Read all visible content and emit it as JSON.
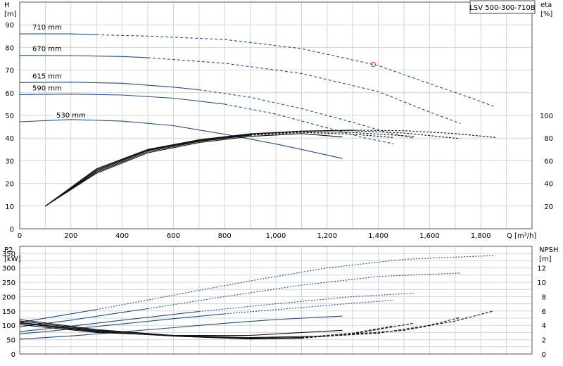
{
  "chart_data": [
    {
      "id": "head-efficiency",
      "type": "line",
      "model_label": "LSV 500-300-710B",
      "ylabel_left": "H",
      "ylabel_left_unit": "[m]",
      "ylabel_right": "eta",
      "ylabel_right_unit": "[%]",
      "xlabel": "Q [m³/h]",
      "xlim": [
        0,
        2000
      ],
      "ylim_left": [
        0,
        100
      ],
      "ylim_right": [
        0,
        200
      ],
      "x_ticks": [
        0,
        200,
        400,
        600,
        800,
        1000,
        1200,
        1400,
        1600,
        1800
      ],
      "x_tick_labels": [
        "0",
        "200",
        "400",
        "600",
        "800",
        "1,000",
        "1,200",
        "1,400",
        "1,600",
        "1,800"
      ],
      "y_left_ticks": [
        0,
        10,
        20,
        30,
        40,
        50,
        60,
        70,
        80,
        90
      ],
      "y_right_ticks": [
        20,
        40,
        60,
        80,
        100
      ],
      "grid": true,
      "color": "#1f4e8c",
      "efficiency_color": "#111111",
      "duty_point": {
        "x": 1380,
        "y": 72.5,
        "color": "#e03030"
      },
      "head_series": [
        {
          "name": "710 mm",
          "solid": [
            [
              0,
              86
            ],
            [
              100,
              86
            ],
            [
              200,
              86
            ],
            [
              300,
              85.6
            ]
          ],
          "dashed": [
            [
              300,
              85.6
            ],
            [
              500,
              85
            ],
            [
              800,
              83.5
            ],
            [
              1100,
              79.5
            ],
            [
              1400,
              72
            ],
            [
              1600,
              64
            ],
            [
              1780,
              57
            ],
            [
              1850,
              54
            ]
          ]
        },
        {
          "name": "670 mm",
          "solid": [
            [
              0,
              76.5
            ],
            [
              200,
              76.4
            ],
            [
              400,
              76
            ],
            [
              500,
              75.5
            ]
          ],
          "dashed": [
            [
              500,
              75.5
            ],
            [
              800,
              73
            ],
            [
              1100,
              68.5
            ],
            [
              1400,
              60.5
            ],
            [
              1600,
              51.5
            ],
            [
              1720,
              46.5
            ]
          ]
        },
        {
          "name": "615 mm",
          "solid": [
            [
              0,
              64.5
            ],
            [
              200,
              64.7
            ],
            [
              400,
              64.2
            ],
            [
              600,
              62.5
            ],
            [
              700,
              61.3
            ]
          ],
          "dashed": [
            [
              700,
              61.3
            ],
            [
              900,
              58
            ],
            [
              1100,
              53
            ],
            [
              1300,
              47
            ],
            [
              1450,
              42
            ],
            [
              1540,
              40
            ]
          ]
        },
        {
          "name": "590 mm",
          "solid": [
            [
              0,
              59.2
            ],
            [
              200,
              59.4
            ],
            [
              400,
              59
            ],
            [
              600,
              57.6
            ],
            [
              800,
              55
            ]
          ],
          "dashed": [
            [
              800,
              55
            ],
            [
              1000,
              50.6
            ],
            [
              1200,
              44.5
            ],
            [
              1350,
              40
            ],
            [
              1460,
              37.5
            ]
          ]
        },
        {
          "name": "530 mm",
          "solid": [
            [
              0,
              47.2
            ],
            [
              200,
              48.2
            ],
            [
              400,
              47.5
            ],
            [
              600,
              45.5
            ],
            [
              800,
              41.7
            ],
            [
              1000,
              37.4
            ],
            [
              1100,
              35
            ],
            [
              1260,
              31
            ]
          ],
          "dashed": []
        }
      ],
      "efficiency_series": [
        {
          "name": "710 mm",
          "solid": [
            [
              100,
              20
            ],
            [
              300,
              53
            ],
            [
              500,
              70
            ],
            [
              700,
              78.5
            ],
            [
              900,
              83.8
            ],
            [
              1100,
              86.2
            ],
            [
              1300,
              87
            ]
          ],
          "dashed": [
            [
              1300,
              87
            ],
            [
              1500,
              86.5
            ],
            [
              1700,
              84
            ],
            [
              1860,
              80.5
            ]
          ]
        },
        {
          "name": "670 mm",
          "solid": [
            [
              100,
              20
            ],
            [
              300,
              52
            ],
            [
              500,
              69.5
            ],
            [
              700,
              78
            ],
            [
              900,
              83.5
            ],
            [
              1100,
              86
            ]
          ],
          "dashed": [
            [
              1100,
              86
            ],
            [
              1300,
              86.5
            ],
            [
              1500,
              84.5
            ],
            [
              1720,
              79.5
            ]
          ]
        },
        {
          "name": "615 mm",
          "solid": [
            [
              100,
              20
            ],
            [
              300,
              51
            ],
            [
              500,
              69
            ],
            [
              700,
              77.6
            ],
            [
              900,
              83
            ]
          ],
          "dashed": [
            [
              900,
              83
            ],
            [
              1100,
              85.5
            ],
            [
              1300,
              85
            ],
            [
              1540,
              81.5
            ]
          ]
        },
        {
          "name": "590 mm",
          "solid": [
            [
              100,
              20
            ],
            [
              300,
              50
            ],
            [
              500,
              68
            ],
            [
              700,
              77
            ],
            [
              900,
              82.5
            ]
          ],
          "dashed": [
            [
              900,
              82.5
            ],
            [
              1100,
              85
            ],
            [
              1300,
              83.5
            ],
            [
              1460,
              80.5
            ]
          ]
        },
        {
          "name": "530 mm",
          "solid": [
            [
              100,
              20
            ],
            [
              300,
              49
            ],
            [
              500,
              67
            ],
            [
              700,
              76
            ],
            [
              900,
              81.5
            ],
            [
              1100,
              84
            ],
            [
              1260,
              81
            ]
          ],
          "dashed": []
        }
      ]
    },
    {
      "id": "power-npsh",
      "type": "line",
      "ylabel_left": "P2",
      "ylabel_left_unit": "[kW]",
      "ylabel_right": "NPSH",
      "ylabel_right_unit": "[m]",
      "xlim": [
        0,
        2000
      ],
      "ylim_left": [
        0,
        375
      ],
      "ylim_right": [
        0,
        15
      ],
      "y_left_ticks": [
        0,
        50,
        100,
        150,
        200,
        250,
        300,
        350
      ],
      "y_right_ticks": [
        0,
        2,
        4,
        6,
        8,
        10,
        12
      ],
      "grid": true,
      "color": "#1f4e8c",
      "npsh_color": "#111111",
      "power_series": [
        {
          "name": "710 mm",
          "solid": [
            [
              0,
              110
            ],
            [
              200,
              140
            ],
            [
              300,
              155
            ]
          ],
          "dashed": [
            [
              300,
              155
            ],
            [
              600,
              205
            ],
            [
              900,
              255
            ],
            [
              1200,
              300
            ],
            [
              1500,
              330
            ],
            [
              1850,
              343
            ]
          ]
        },
        {
          "name": "670 mm",
          "solid": [
            [
              0,
              95
            ],
            [
              200,
              118
            ],
            [
              400,
              145
            ],
            [
              500,
              158
            ]
          ],
          "dashed": [
            [
              500,
              158
            ],
            [
              800,
              200
            ],
            [
              1100,
              240
            ],
            [
              1400,
              270
            ],
            [
              1720,
              282
            ]
          ]
        },
        {
          "name": "615 mm",
          "solid": [
            [
              0,
              78
            ],
            [
              200,
              97
            ],
            [
              400,
              118
            ],
            [
              600,
              138
            ],
            [
              700,
              148
            ]
          ],
          "dashed": [
            [
              700,
              148
            ],
            [
              1000,
              175
            ],
            [
              1300,
              200
            ],
            [
              1540,
              212
            ]
          ]
        },
        {
          "name": "590 mm",
          "solid": [
            [
              0,
              70
            ],
            [
              200,
              87
            ],
            [
              400,
              105
            ],
            [
              600,
              123
            ],
            [
              800,
              140
            ]
          ],
          "dashed": [
            [
              800,
              140
            ],
            [
              1100,
              162
            ],
            [
              1300,
              177
            ],
            [
              1460,
              187
            ]
          ]
        },
        {
          "name": "530 mm",
          "solid": [
            [
              0,
              52
            ],
            [
              200,
              63
            ],
            [
              400,
              77
            ],
            [
              600,
              92
            ],
            [
              800,
              107
            ],
            [
              1000,
              120
            ],
            [
              1260,
              132
            ]
          ],
          "dashed": []
        }
      ],
      "npsh_series": [
        {
          "name": "710 mm",
          "solid": [
            [
              0,
              4.8
            ],
            [
              300,
              3.4
            ],
            [
              600,
              2.6
            ],
            [
              900,
              2.3
            ],
            [
              1200,
              2.5
            ]
          ],
          "dashed": [
            [
              1200,
              2.5
            ],
            [
              1500,
              3.3
            ],
            [
              1700,
              4.6
            ],
            [
              1850,
              6.0
            ]
          ]
        },
        {
          "name": "670 mm",
          "solid": [
            [
              0,
              4.6
            ],
            [
              300,
              3.3
            ],
            [
              600,
              2.6
            ],
            [
              900,
              2.2
            ],
            [
              1100,
              2.3
            ]
          ],
          "dashed": [
            [
              1100,
              2.3
            ],
            [
              1400,
              2.9
            ],
            [
              1600,
              4.0
            ],
            [
              1720,
              5.1
            ]
          ]
        },
        {
          "name": "615 mm",
          "solid": [
            [
              0,
              4.4
            ],
            [
              300,
              3.2
            ],
            [
              600,
              2.5
            ],
            [
              900,
              2.1
            ],
            [
              1100,
              2.2
            ]
          ],
          "dashed": [
            [
              1100,
              2.2
            ],
            [
              1300,
              2.8
            ],
            [
              1540,
              4.3
            ]
          ]
        },
        {
          "name": "590 mm",
          "solid": [
            [
              0,
              4.3
            ],
            [
              300,
              3.1
            ],
            [
              600,
              2.5
            ],
            [
              900,
              2.1
            ],
            [
              1100,
              2.3
            ]
          ],
          "dashed": [
            [
              1100,
              2.3
            ],
            [
              1300,
              2.9
            ],
            [
              1460,
              3.9
            ]
          ]
        },
        {
          "name": "530 mm",
          "solid": [
            [
              0,
              4.1
            ],
            [
              300,
              3.0
            ],
            [
              600,
              2.6
            ],
            [
              900,
              2.6
            ],
            [
              1260,
              3.3
            ]
          ],
          "dashed": []
        }
      ]
    }
  ]
}
